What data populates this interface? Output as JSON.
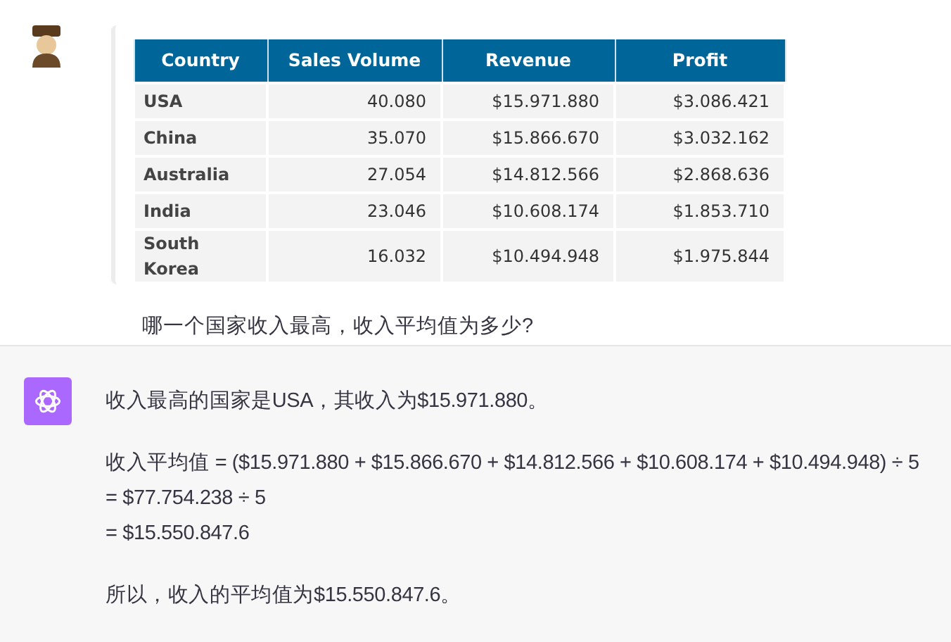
{
  "user_message": {
    "table_image": {
      "columns": [
        "Country",
        "Sales Volume",
        "Revenue",
        "Profit"
      ],
      "rows": [
        [
          "USA",
          "40.080",
          "$15.971.880",
          "$3.086.421"
        ],
        [
          "China",
          "35.070",
          "$15.866.670",
          "$3.032.162"
        ],
        [
          "Australia",
          "27.054",
          "$14.812.566",
          "$2.868.636"
        ],
        [
          "India",
          "23.046",
          "$10.608.174",
          "$1.853.710"
        ],
        [
          "South Korea",
          "16.032",
          "$10.494.948",
          "$1.975.844"
        ]
      ]
    },
    "text": "哪一个国家收入最高，收入平均值为多少?"
  },
  "assistant_message": {
    "paragraphs": [
      {
        "lines": [
          "收入最高的国家是USA，其收入为$15.971.880。"
        ]
      },
      {
        "lines": [
          "收入平均值 = ($15.971.880 + $15.866.670 + $14.812.566 + $10.608.174 + $10.494.948) ÷ 5",
          "= $77.754.238 ÷ 5",
          "= $15.550.847.6"
        ]
      },
      {
        "lines": [
          "所以，收入的平均值为$15.550.847.6。"
        ]
      }
    ]
  }
}
